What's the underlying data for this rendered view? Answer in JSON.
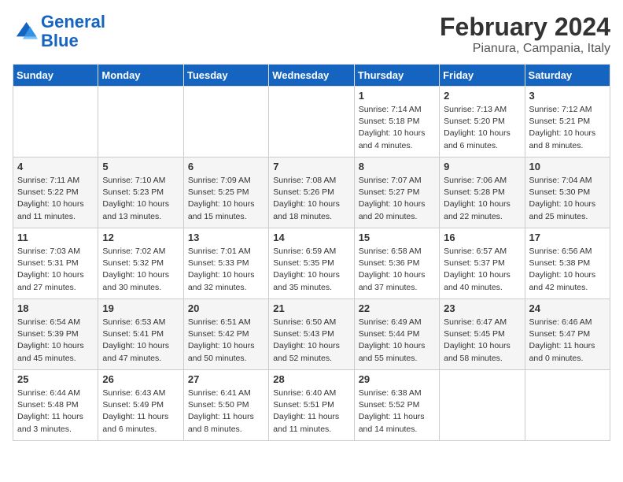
{
  "header": {
    "logo_line1": "General",
    "logo_line2": "Blue",
    "main_title": "February 2024",
    "subtitle": "Pianura, Campania, Italy"
  },
  "days_of_week": [
    "Sunday",
    "Monday",
    "Tuesday",
    "Wednesday",
    "Thursday",
    "Friday",
    "Saturday"
  ],
  "weeks": [
    [
      {
        "day": "",
        "info": ""
      },
      {
        "day": "",
        "info": ""
      },
      {
        "day": "",
        "info": ""
      },
      {
        "day": "",
        "info": ""
      },
      {
        "day": "1",
        "info": "Sunrise: 7:14 AM\nSunset: 5:18 PM\nDaylight: 10 hours\nand 4 minutes."
      },
      {
        "day": "2",
        "info": "Sunrise: 7:13 AM\nSunset: 5:20 PM\nDaylight: 10 hours\nand 6 minutes."
      },
      {
        "day": "3",
        "info": "Sunrise: 7:12 AM\nSunset: 5:21 PM\nDaylight: 10 hours\nand 8 minutes."
      }
    ],
    [
      {
        "day": "4",
        "info": "Sunrise: 7:11 AM\nSunset: 5:22 PM\nDaylight: 10 hours\nand 11 minutes."
      },
      {
        "day": "5",
        "info": "Sunrise: 7:10 AM\nSunset: 5:23 PM\nDaylight: 10 hours\nand 13 minutes."
      },
      {
        "day": "6",
        "info": "Sunrise: 7:09 AM\nSunset: 5:25 PM\nDaylight: 10 hours\nand 15 minutes."
      },
      {
        "day": "7",
        "info": "Sunrise: 7:08 AM\nSunset: 5:26 PM\nDaylight: 10 hours\nand 18 minutes."
      },
      {
        "day": "8",
        "info": "Sunrise: 7:07 AM\nSunset: 5:27 PM\nDaylight: 10 hours\nand 20 minutes."
      },
      {
        "day": "9",
        "info": "Sunrise: 7:06 AM\nSunset: 5:28 PM\nDaylight: 10 hours\nand 22 minutes."
      },
      {
        "day": "10",
        "info": "Sunrise: 7:04 AM\nSunset: 5:30 PM\nDaylight: 10 hours\nand 25 minutes."
      }
    ],
    [
      {
        "day": "11",
        "info": "Sunrise: 7:03 AM\nSunset: 5:31 PM\nDaylight: 10 hours\nand 27 minutes."
      },
      {
        "day": "12",
        "info": "Sunrise: 7:02 AM\nSunset: 5:32 PM\nDaylight: 10 hours\nand 30 minutes."
      },
      {
        "day": "13",
        "info": "Sunrise: 7:01 AM\nSunset: 5:33 PM\nDaylight: 10 hours\nand 32 minutes."
      },
      {
        "day": "14",
        "info": "Sunrise: 6:59 AM\nSunset: 5:35 PM\nDaylight: 10 hours\nand 35 minutes."
      },
      {
        "day": "15",
        "info": "Sunrise: 6:58 AM\nSunset: 5:36 PM\nDaylight: 10 hours\nand 37 minutes."
      },
      {
        "day": "16",
        "info": "Sunrise: 6:57 AM\nSunset: 5:37 PM\nDaylight: 10 hours\nand 40 minutes."
      },
      {
        "day": "17",
        "info": "Sunrise: 6:56 AM\nSunset: 5:38 PM\nDaylight: 10 hours\nand 42 minutes."
      }
    ],
    [
      {
        "day": "18",
        "info": "Sunrise: 6:54 AM\nSunset: 5:39 PM\nDaylight: 10 hours\nand 45 minutes."
      },
      {
        "day": "19",
        "info": "Sunrise: 6:53 AM\nSunset: 5:41 PM\nDaylight: 10 hours\nand 47 minutes."
      },
      {
        "day": "20",
        "info": "Sunrise: 6:51 AM\nSunset: 5:42 PM\nDaylight: 10 hours\nand 50 minutes."
      },
      {
        "day": "21",
        "info": "Sunrise: 6:50 AM\nSunset: 5:43 PM\nDaylight: 10 hours\nand 52 minutes."
      },
      {
        "day": "22",
        "info": "Sunrise: 6:49 AM\nSunset: 5:44 PM\nDaylight: 10 hours\nand 55 minutes."
      },
      {
        "day": "23",
        "info": "Sunrise: 6:47 AM\nSunset: 5:45 PM\nDaylight: 10 hours\nand 58 minutes."
      },
      {
        "day": "24",
        "info": "Sunrise: 6:46 AM\nSunset: 5:47 PM\nDaylight: 11 hours\nand 0 minutes."
      }
    ],
    [
      {
        "day": "25",
        "info": "Sunrise: 6:44 AM\nSunset: 5:48 PM\nDaylight: 11 hours\nand 3 minutes."
      },
      {
        "day": "26",
        "info": "Sunrise: 6:43 AM\nSunset: 5:49 PM\nDaylight: 11 hours\nand 6 minutes."
      },
      {
        "day": "27",
        "info": "Sunrise: 6:41 AM\nSunset: 5:50 PM\nDaylight: 11 hours\nand 8 minutes."
      },
      {
        "day": "28",
        "info": "Sunrise: 6:40 AM\nSunset: 5:51 PM\nDaylight: 11 hours\nand 11 minutes."
      },
      {
        "day": "29",
        "info": "Sunrise: 6:38 AM\nSunset: 5:52 PM\nDaylight: 11 hours\nand 14 minutes."
      },
      {
        "day": "",
        "info": ""
      },
      {
        "day": "",
        "info": ""
      }
    ]
  ]
}
